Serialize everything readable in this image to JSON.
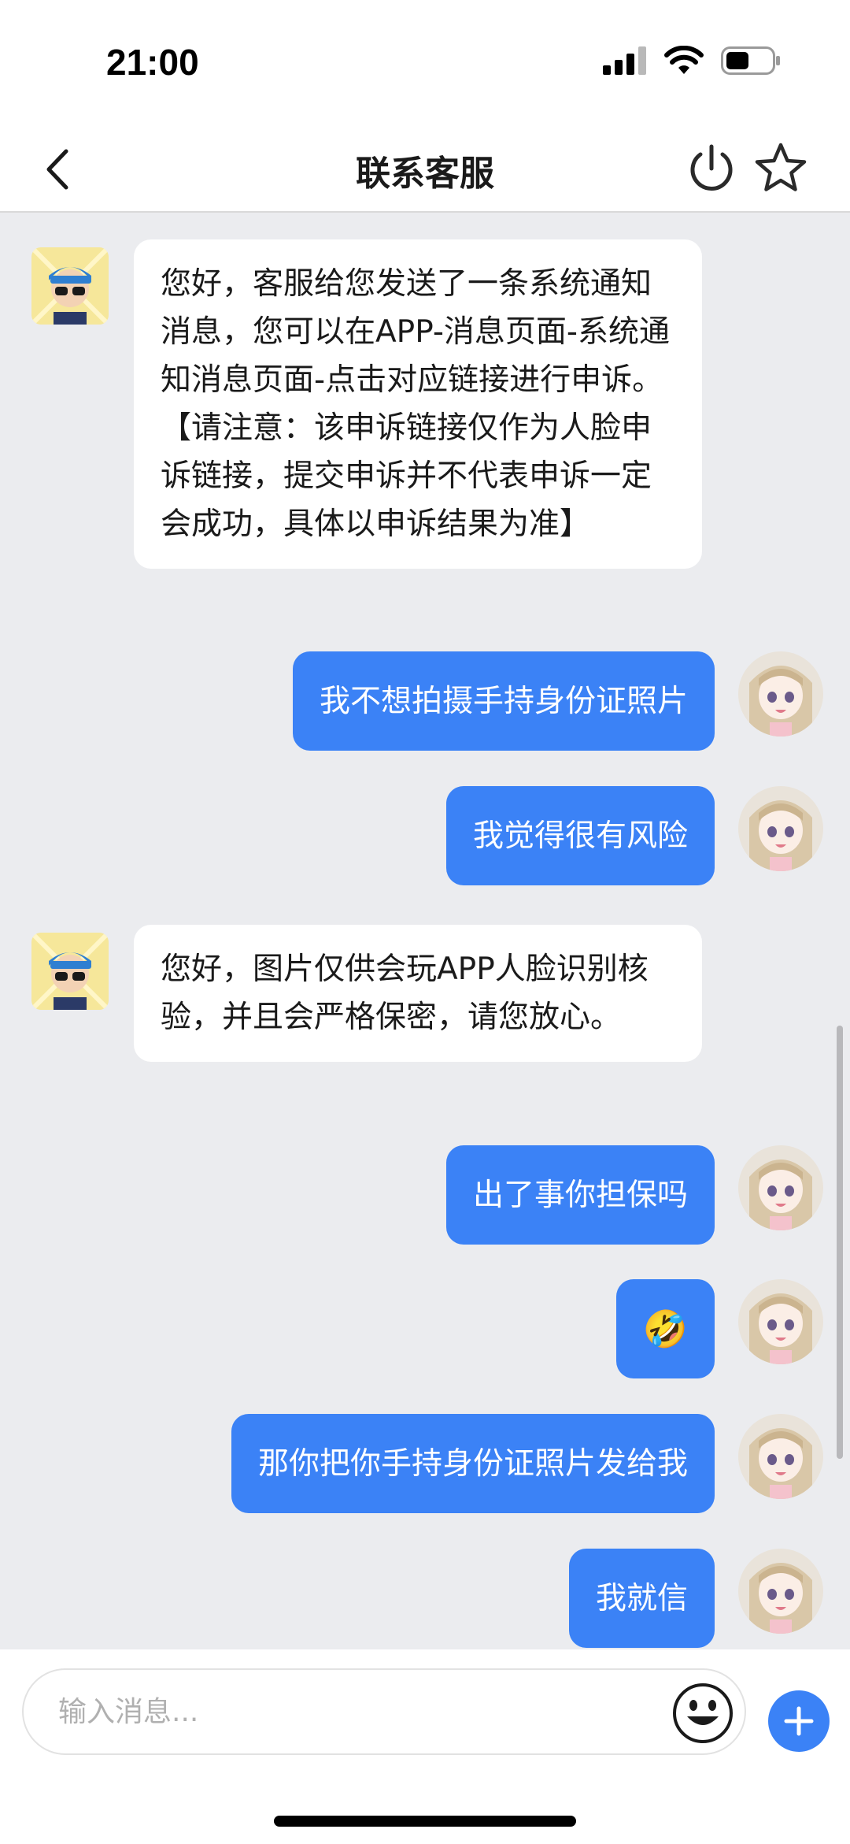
{
  "status_bar": {
    "time": "21:00"
  },
  "nav": {
    "title": "联系客服"
  },
  "messages": [
    {
      "from": "agent",
      "text": "您好，客服给您发送了一条系统通知消息，您可以在APP-消息页面-系统通知消息页面-点击对应链接进行申诉。【请注意：该申诉链接仅作为人脸申诉链接，提交申诉并不代表申诉一定会成功，具体以申诉结果为准】"
    },
    {
      "from": "user",
      "text": "我不想拍摄手持身份证照片"
    },
    {
      "from": "user",
      "text": "我觉得很有风险"
    },
    {
      "from": "agent",
      "text": "您好，图片仅供会玩APP人脸识别核验，并且会严格保密，请您放心。"
    },
    {
      "from": "user",
      "text": "出了事你担保吗"
    },
    {
      "from": "user",
      "text": "🤣"
    },
    {
      "from": "user",
      "text": "那你把你手持身份证照片发给我"
    },
    {
      "from": "user",
      "text": "我就信"
    }
  ],
  "input": {
    "placeholder": "输入消息..."
  },
  "colors": {
    "accent": "#3b82f6",
    "chat_background": "#ebecef",
    "agent_bubble": "#ffffff"
  }
}
